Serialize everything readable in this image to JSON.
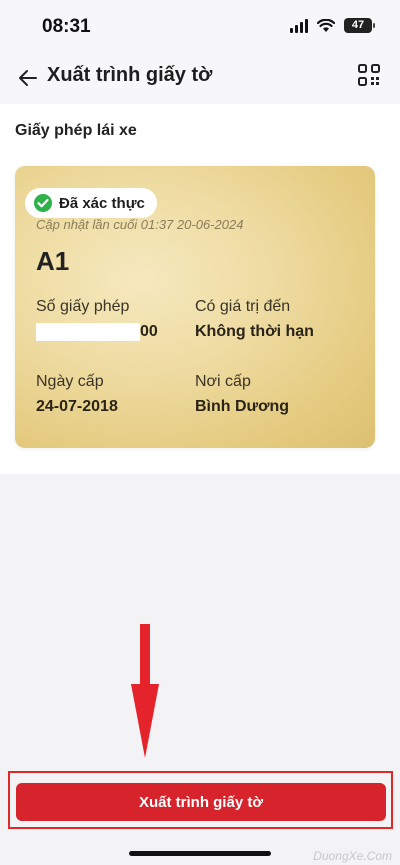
{
  "status_bar": {
    "time": "08:31",
    "battery": "47"
  },
  "header": {
    "title": "Xuất trình giấy tờ",
    "back_icon": "back-arrow-icon",
    "qr_icon": "qr-scan-icon"
  },
  "section": {
    "title": "Giấy phép lái xe"
  },
  "card": {
    "status": "Đã xác thực",
    "updated": "Cập nhật lần cuối 01:37 20-06-2024",
    "license_class": "A1",
    "fields": {
      "license_no_label": "Số giấy phép",
      "license_no_suffix": "00",
      "valid_until_label": "Có giá trị đến",
      "valid_until_value": "Không thời hạn",
      "issue_date_label": "Ngày cấp",
      "issue_date_value": "24-07-2018",
      "issue_place_label": "Nơi cấp",
      "issue_place_value": "Bình Dương"
    }
  },
  "action": {
    "button_label": "Xuất trình giấy tờ"
  },
  "watermark": "DuongXe.Com",
  "colors": {
    "accent": "#d7232b",
    "verified": "#2fb24a",
    "highlight": "#e02828"
  }
}
